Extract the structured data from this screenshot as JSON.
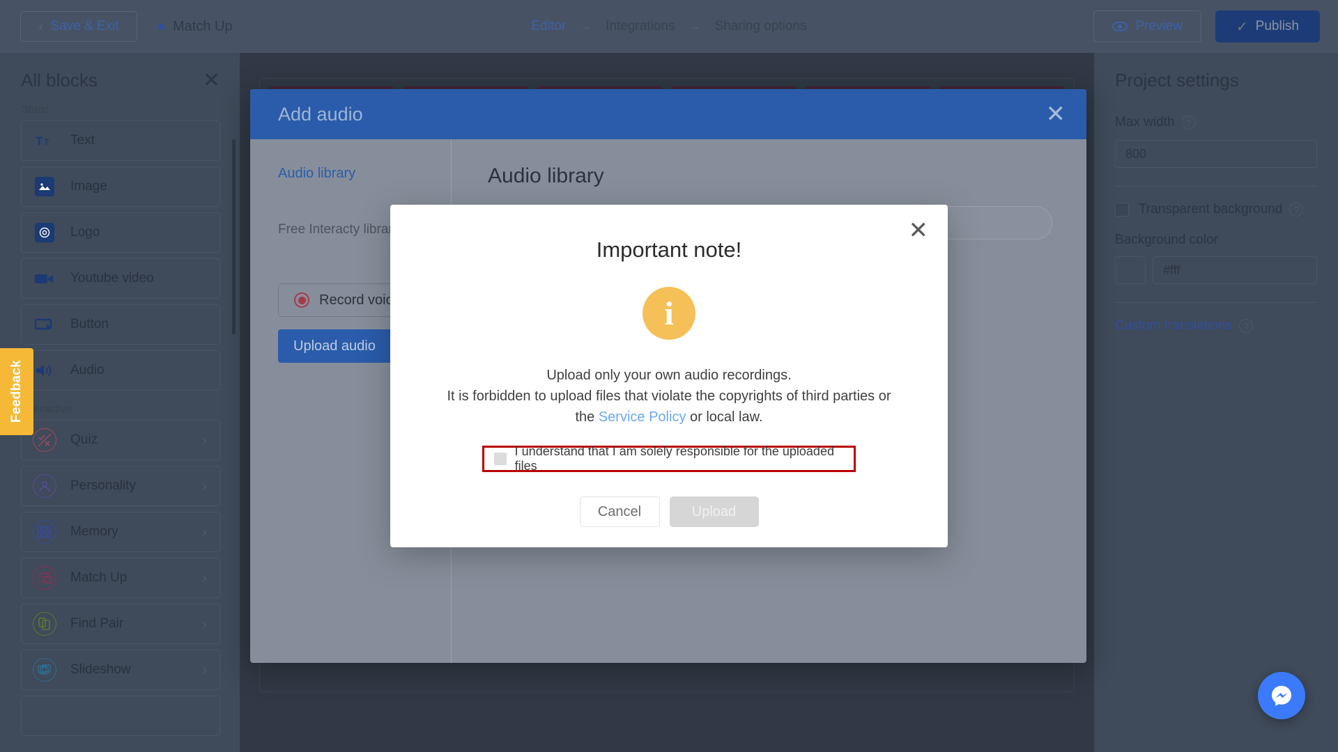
{
  "topbar": {
    "save_exit": "Save & Exit",
    "project_name": "Match Up",
    "breadcrumb": [
      "Editor",
      "Integrations",
      "Sharing options"
    ],
    "preview": "Preview",
    "publish": "Publish",
    "back_icon": "chevron-left-icon",
    "preview_icon": "eye-icon",
    "publish_icon": "check-icon",
    "accent_blue": "#3e61a8",
    "publish_bg": "#1d3c77"
  },
  "sidebar": {
    "title": "All blocks",
    "close_icon": "close-icon",
    "groups": [
      {
        "label": "Static",
        "items": [
          {
            "label": "Text",
            "icon": "text-icon",
            "has_chevron": false
          },
          {
            "label": "Image",
            "icon": "image-icon",
            "has_chevron": false
          },
          {
            "label": "Logo",
            "icon": "logo-icon",
            "has_chevron": false
          },
          {
            "label": "Youtube video",
            "icon": "video-camera-icon",
            "has_chevron": false
          },
          {
            "label": "Button",
            "icon": "button-icon",
            "has_chevron": false
          },
          {
            "label": "Audio",
            "icon": "speaker-icon",
            "has_chevron": false
          }
        ]
      },
      {
        "label": "Interactive",
        "items": [
          {
            "label": "Quiz",
            "icon": "quiz-icon",
            "has_chevron": true,
            "color": "#a04a5e"
          },
          {
            "label": "Personality",
            "icon": "person-icon",
            "has_chevron": true,
            "color": "#5a4a9e"
          },
          {
            "label": "Memory",
            "icon": "memory-grid-icon",
            "has_chevron": true,
            "color": "#3a4b9e"
          },
          {
            "label": "Match Up",
            "icon": "match-up-icon",
            "has_chevron": true,
            "color": "#8e2f55"
          },
          {
            "label": "Find Pair",
            "icon": "find-pair-icon",
            "has_chevron": true,
            "color": "#5d7a30"
          },
          {
            "label": "Slideshow",
            "icon": "slideshow-icon",
            "has_chevron": true,
            "color": "#2e6f93"
          }
        ]
      }
    ],
    "feedback_tab": "Feedback",
    "feedback_color": "#f5b937"
  },
  "project_settings": {
    "title": "Project settings",
    "max_width_label": "Max width",
    "max_width_value": "800",
    "transparent_bg_label": "Transparent background",
    "transparent_bg_checked": false,
    "background_color_label": "Background color",
    "background_color_value": "#fff",
    "custom_translations_label": "Custom translations",
    "help_icon": "question-mark-icon"
  },
  "add_audio_modal": {
    "title": "Add audio",
    "close_icon": "close-icon",
    "left": {
      "tab_label": "Audio library",
      "subtitle": "Free Interacty library",
      "record_button": "Record voice",
      "record_icon": "record-dot-icon",
      "upload_button": "Upload audio"
    },
    "right": {
      "heading": "Audio library",
      "search_placeholder": ""
    },
    "header_color": "#2a5cab"
  },
  "important_note": {
    "close_icon": "close-icon",
    "title": "Important note!",
    "icon": "info-icon",
    "icon_color": "#f5c057",
    "line1": "Upload only your own audio recordings.",
    "line2": "It is forbidden to upload files that violate the copyrights of third parties or",
    "line3_prefix": "the ",
    "policy_link": "Service Policy",
    "line3_suffix": " or local law.",
    "checkbox_label": "I understand that I am solely responsible for the uploaded files",
    "checkbox_checked": false,
    "highlight_color": "#bb0000",
    "cancel_button": "Cancel",
    "upload_button": "Upload",
    "upload_disabled": true
  },
  "chat_fab": {
    "icon": "messenger-icon",
    "color": "#3b7bfb"
  }
}
